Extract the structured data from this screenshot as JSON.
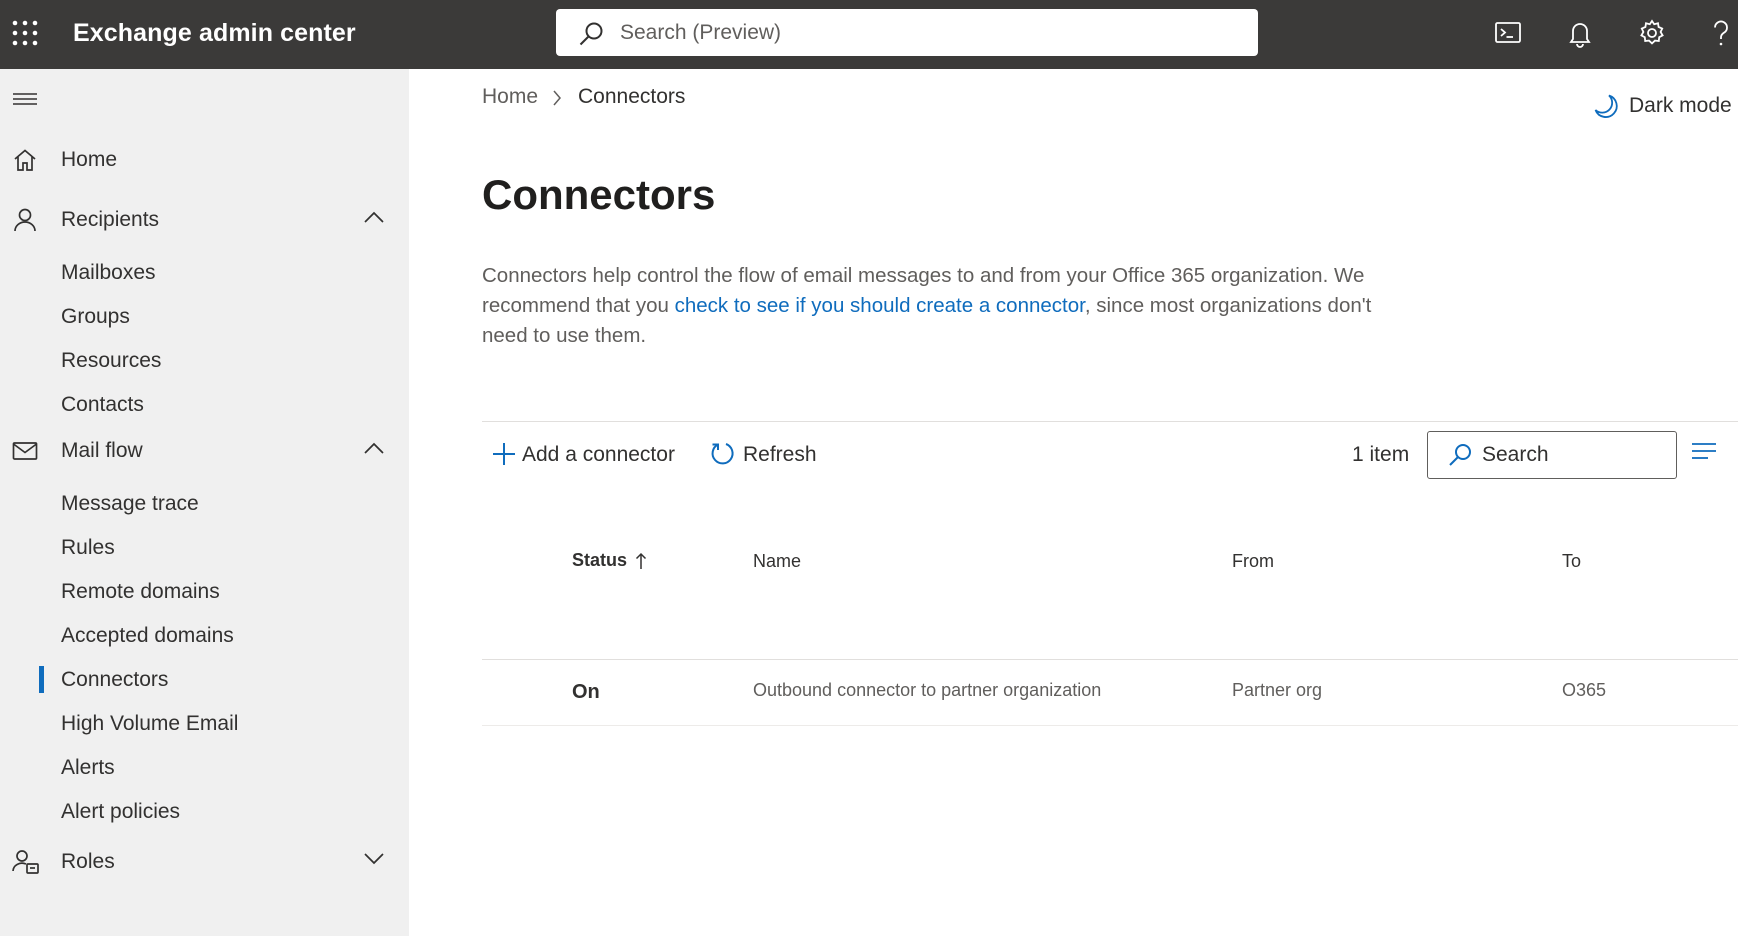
{
  "header": {
    "app_title": "Exchange admin center",
    "search_placeholder": "Search (Preview)",
    "icons": [
      "waffle-icon",
      "cloud-shell-icon",
      "notifications-icon",
      "settings-icon",
      "help-icon"
    ]
  },
  "sidebar": {
    "nav": [
      {
        "label": "Home",
        "icon": "home-icon"
      },
      {
        "label": "Recipients",
        "icon": "person-icon",
        "expanded": true
      },
      {
        "label": "Mail flow",
        "icon": "mail-icon",
        "expanded": true
      },
      {
        "label": "Roles",
        "icon": "roles-icon",
        "expanded": false
      }
    ],
    "recipients_items": [
      "Mailboxes",
      "Groups",
      "Resources",
      "Contacts"
    ],
    "mailflow_items": [
      "Message trace",
      "Rules",
      "Remote domains",
      "Accepted domains",
      "Connectors",
      "High Volume Email",
      "Alerts",
      "Alert policies"
    ],
    "active_item": "Connectors"
  },
  "breadcrumb": {
    "home": "Home",
    "current": "Connectors"
  },
  "dark_mode_label": "Dark mode",
  "page": {
    "title": "Connectors",
    "description_before": "Connectors help control the flow of email messages to and from your Office 365 organization. We recommend that you ",
    "description_link": "check to see if you should create a connector",
    "description_after": ", since most organizations don't need to use them."
  },
  "commands": {
    "add_label": "Add a connector",
    "refresh_label": "Refresh",
    "item_count": "1 item",
    "search_placeholder": "Search"
  },
  "table": {
    "columns": {
      "status": "Status",
      "name": "Name",
      "from": "From",
      "to": "To"
    },
    "sort_column": "Status",
    "rows": [
      {
        "status": "On",
        "name": "Outbound connector to partner organization",
        "from": "Partner org",
        "to": "O365"
      }
    ]
  },
  "colors": {
    "topbar": "#3b3a39",
    "sidebar": "#f0f0f0",
    "accent": "#0f6cbd",
    "link": "#0f6cbd"
  }
}
